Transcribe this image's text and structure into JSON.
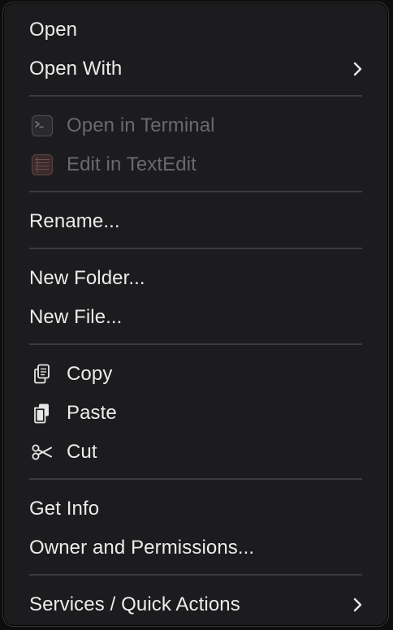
{
  "menu": {
    "open": "Open",
    "open_with": "Open With",
    "open_in_terminal": "Open in Terminal",
    "edit_in_textedit": "Edit in TextEdit",
    "rename": "Rename...",
    "new_folder": "New Folder...",
    "new_file": "New File...",
    "copy": "Copy",
    "paste": "Paste",
    "cut": "Cut",
    "get_info": "Get Info",
    "owner_permissions": "Owner and Permissions...",
    "services": "Services / Quick Actions"
  },
  "icons": {
    "terminal": "terminal-app-icon",
    "textedit": "textedit-app-icon",
    "copy": "copy-icon",
    "paste": "paste-icon",
    "cut": "scissors-icon",
    "submenu": "chevron-right-icon"
  },
  "colors": {
    "menu_background": "#1c1c1e",
    "text": "#ececec",
    "disabled_text": "#6a6a6c",
    "separator": "#3b3b3d"
  }
}
